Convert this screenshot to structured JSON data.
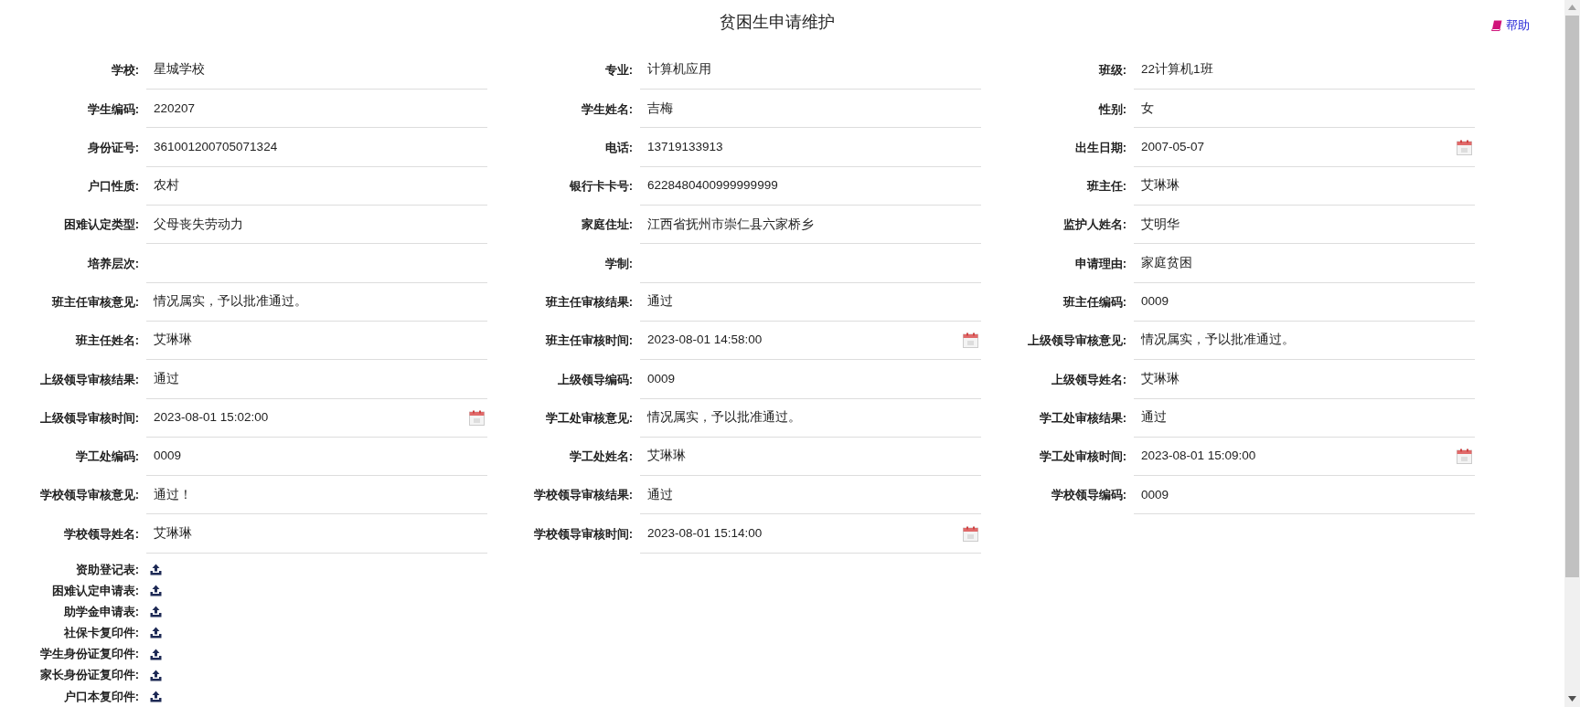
{
  "title": "贫困生申请维护",
  "help_link": "帮助",
  "fields": [
    {
      "label": "学校:",
      "value": "星城学校",
      "kind": "text"
    },
    {
      "label": "专业:",
      "value": "计算机应用",
      "kind": "text"
    },
    {
      "label": "班级:",
      "value": "22计算机1班",
      "kind": "text"
    },
    {
      "label": "学生编码:",
      "value": "220207",
      "kind": "text"
    },
    {
      "label": "学生姓名:",
      "value": "吉梅",
      "kind": "text"
    },
    {
      "label": "性别:",
      "value": "女",
      "kind": "text"
    },
    {
      "label": "身份证号:",
      "value": "361001200705071324",
      "kind": "text"
    },
    {
      "label": "电话:",
      "value": "13719133913",
      "kind": "text"
    },
    {
      "label": "出生日期:",
      "value": "2007-05-07",
      "kind": "date"
    },
    {
      "label": "户口性质:",
      "value": "农村",
      "kind": "text"
    },
    {
      "label": "银行卡卡号:",
      "value": "6228480400999999999",
      "kind": "text"
    },
    {
      "label": "班主任:",
      "value": "艾琳琳",
      "kind": "text"
    },
    {
      "label": "困难认定类型:",
      "value": "父母丧失劳动力",
      "kind": "text"
    },
    {
      "label": "家庭住址:",
      "value": "江西省抚州市崇仁县六家桥乡",
      "kind": "text"
    },
    {
      "label": "监护人姓名:",
      "value": "艾明华",
      "kind": "text"
    },
    {
      "label": "培养层次:",
      "kind": "text"
    },
    {
      "label": "学制:",
      "kind": "text"
    },
    {
      "label": "申请理由:",
      "value": "家庭贫困",
      "kind": "text"
    },
    {
      "label": "班主任审核意见:",
      "value": "情况属实，予以批准通过。",
      "kind": "text"
    },
    {
      "label": "班主任审核结果:",
      "value": "通过",
      "kind": "text"
    },
    {
      "label": "班主任编码:",
      "value": "0009",
      "kind": "text"
    },
    {
      "label": "班主任姓名:",
      "value": "艾琳琳",
      "kind": "text"
    },
    {
      "label": "班主任审核时间:",
      "value": "2023-08-01 14:58:00",
      "kind": "date"
    },
    {
      "label": "上级领导审核意见:",
      "value": "情况属实，予以批准通过。",
      "kind": "text"
    },
    {
      "label": "上级领导审核结果:",
      "value": "通过",
      "kind": "text"
    },
    {
      "label": "上级领导编码:",
      "value": "0009",
      "kind": "text"
    },
    {
      "label": "上级领导姓名:",
      "value": "艾琳琳",
      "kind": "text"
    },
    {
      "label": "上级领导审核时间:",
      "value": "2023-08-01 15:02:00",
      "kind": "date"
    },
    {
      "label": "学工处审核意见:",
      "value": "情况属实，予以批准通过。",
      "kind": "text"
    },
    {
      "label": "学工处审核结果:",
      "value": "通过",
      "kind": "text"
    },
    {
      "label": "学工处编码:",
      "value": "0009",
      "kind": "text"
    },
    {
      "label": "学工处姓名:",
      "value": "艾琳琳",
      "kind": "text"
    },
    {
      "label": "学工处审核时间:",
      "value": "2023-08-01 15:09:00",
      "kind": "date"
    },
    {
      "label": "学校领导审核意见:",
      "value": "通过！",
      "kind": "text"
    },
    {
      "label": "学校领导审核结果:",
      "value": "通过",
      "kind": "text"
    },
    {
      "label": "学校领导编码:",
      "value": "0009",
      "kind": "text"
    },
    {
      "label": "学校领导姓名:",
      "value": "艾琳琳",
      "kind": "text"
    },
    {
      "label": "学校领导审核时间:",
      "value": "2023-08-01 15:14:00",
      "kind": "date"
    }
  ],
  "attachments": [
    {
      "label": "资助登记表:"
    },
    {
      "label": "困难认定申请表:"
    },
    {
      "label": "助学金申请表:"
    },
    {
      "label": "社保卡复印件:"
    },
    {
      "label": "学生身份证复印件:"
    },
    {
      "label": "家长身份证复印件:"
    },
    {
      "label": "户口本复印件:"
    }
  ]
}
